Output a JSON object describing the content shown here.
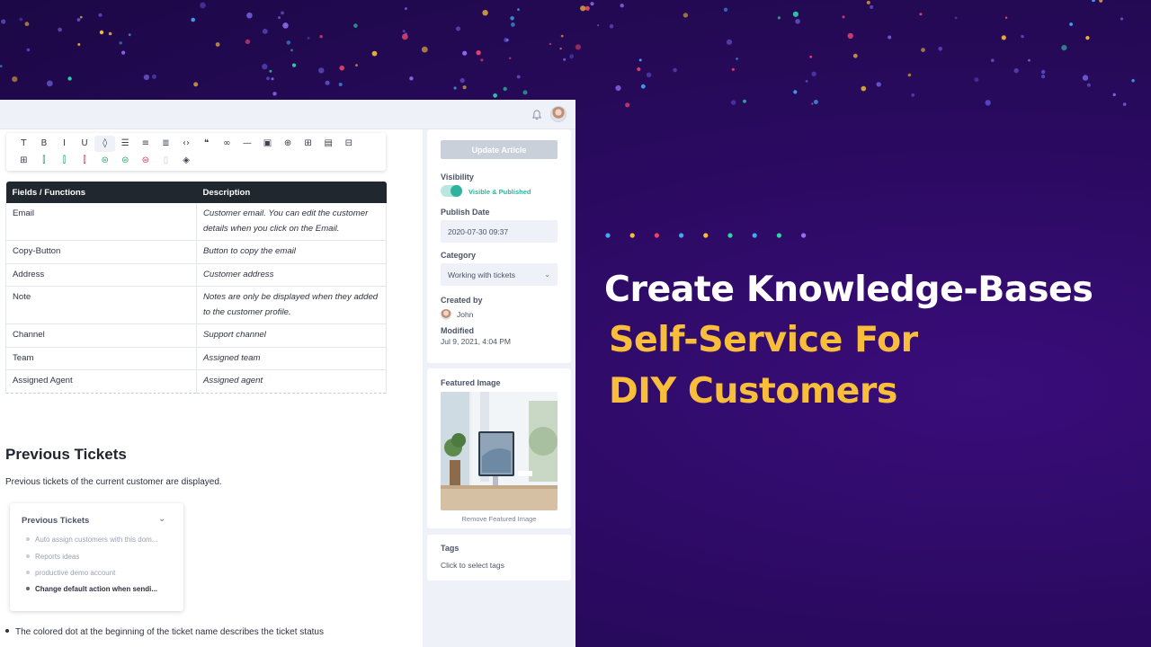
{
  "topbar": {
    "bell_icon": "bell-icon",
    "avatar_icon": "user-avatar"
  },
  "toolbar": {
    "row1": [
      {
        "name": "text-icon",
        "glyph": "T"
      },
      {
        "name": "bold-icon",
        "glyph": "B"
      },
      {
        "name": "italic-icon",
        "glyph": "I"
      },
      {
        "name": "underline-icon",
        "glyph": "U"
      },
      {
        "name": "color-drop-icon",
        "glyph": "◊",
        "active": true
      },
      {
        "name": "bullet-list-icon",
        "glyph": "☰"
      },
      {
        "name": "numbered-list-icon",
        "glyph": "≡"
      },
      {
        "name": "align-icon",
        "glyph": "≣"
      },
      {
        "name": "code-icon",
        "glyph": "‹›"
      },
      {
        "name": "quote-icon",
        "glyph": "❝"
      },
      {
        "name": "link-icon",
        "glyph": "∞"
      },
      {
        "name": "horizontal-rule-icon",
        "glyph": "—"
      },
      {
        "name": "image-icon",
        "glyph": "▣"
      },
      {
        "name": "add-circle-icon",
        "glyph": "⊕"
      },
      {
        "name": "table-icon",
        "glyph": "⊞"
      },
      {
        "name": "document-icon",
        "glyph": "▤"
      },
      {
        "name": "embed-icon",
        "glyph": "⊟"
      }
    ],
    "row2": [
      {
        "name": "table-grid-icon",
        "glyph": "⊞"
      },
      {
        "name": "add-column-after-icon",
        "glyph": "⫿",
        "tone": "green"
      },
      {
        "name": "add-column-before-icon",
        "glyph": "⫿",
        "tone": "green"
      },
      {
        "name": "delete-column-icon",
        "glyph": "⫿",
        "tone": "red"
      },
      {
        "name": "add-row-after-icon",
        "glyph": "⊜",
        "tone": "green"
      },
      {
        "name": "add-row-before-icon",
        "glyph": "⊜",
        "tone": "green"
      },
      {
        "name": "delete-row-icon",
        "glyph": "⊜",
        "tone": "red"
      },
      {
        "name": "merge-cells-icon",
        "glyph": "▯",
        "tone": "muted"
      },
      {
        "name": "cell-fill-icon",
        "glyph": "◈"
      }
    ]
  },
  "table": {
    "headers": [
      "Fields / Functions",
      "Description"
    ],
    "rows": [
      [
        "Email",
        "Customer email. You can edit the customer details when you click on the Email."
      ],
      [
        "Copy-Button",
        "Button to copy the email"
      ],
      [
        "Address",
        "Customer address"
      ],
      [
        "Note",
        "Notes are only be displayed when they added to the customer profile."
      ],
      [
        "Channel",
        "Support channel"
      ],
      [
        "Team",
        "Assigned team"
      ],
      [
        "Assigned Agent",
        "Assigned agent"
      ]
    ]
  },
  "section": {
    "title": "Previous Tickets",
    "subtitle": "Previous tickets of the current customer are displayed."
  },
  "prev_card": {
    "title": "Previous Tickets",
    "items": [
      {
        "label": "Auto assign customers with this dom...",
        "bold": false
      },
      {
        "label": "Reports ideas",
        "bold": false
      },
      {
        "label": "productive demo account",
        "bold": false
      },
      {
        "label": "Change default action when sendi...",
        "bold": true
      }
    ]
  },
  "bullet_text": "The colored dot at the beginning of the ticket name describes the ticket status",
  "sidebar": {
    "update_button": "Update Article",
    "visibility_label": "Visibility",
    "visibility_value": "Visible & Published",
    "visibility_on": true,
    "publish_label": "Publish Date",
    "publish_value": "2020-07-30 09:37",
    "category_label": "Category",
    "category_value": "Working with tickets",
    "created_label": "Created by",
    "created_value": "John",
    "modified_label": "Modified",
    "modified_value": "Jul 9, 2021, 4:04 PM",
    "featured_label": "Featured Image",
    "remove_link": "Remove Featured Image",
    "tags_label": "Tags",
    "tags_hint": "Click to select tags"
  },
  "hero": {
    "line1": "Create Knowledge-Bases",
    "line2": "Self-Service For",
    "line3": "DIY Customers"
  },
  "colors": {
    "accent_yellow": "#f7bd3b",
    "accent_teal": "#2db3a0",
    "background_purple": "#2a0a60",
    "header_dark": "#20272f",
    "dots": [
      "#3fa9f5",
      "#f7bd3b",
      "#e8436a",
      "#3fa9f5",
      "#f7bd3b",
      "#2dd4a7",
      "#3fa9f5",
      "#2dd4a7",
      "#9b6cf5"
    ]
  }
}
